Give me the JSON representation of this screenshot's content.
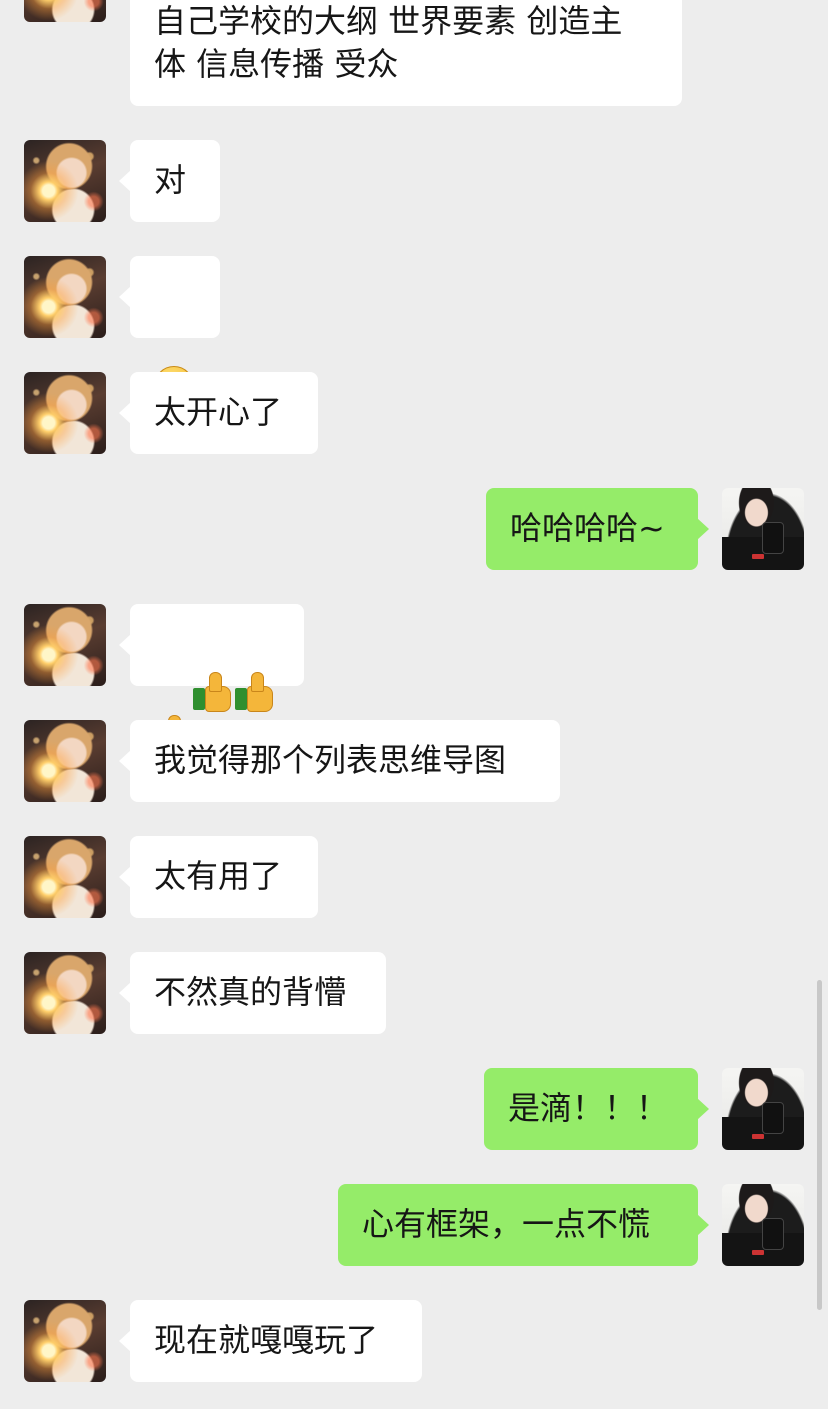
{
  "messages": [
    {
      "side": "in",
      "text": "自己学校的大纲 世界要素 创造主\n体 信息传播 受众"
    },
    {
      "side": "in",
      "text": "对"
    },
    {
      "side": "in",
      "emoji": "grinning-face"
    },
    {
      "side": "in",
      "text": "太开心了"
    },
    {
      "side": "out",
      "text": "哈哈哈哈~"
    },
    {
      "side": "in",
      "emoji": "thumbs-up-x3"
    },
    {
      "side": "in",
      "text": "我觉得那个列表思维导图"
    },
    {
      "side": "in",
      "text": "太有用了"
    },
    {
      "side": "in",
      "text": "不然真的背懵"
    },
    {
      "side": "out",
      "text": "是滴！！！"
    },
    {
      "side": "out",
      "text": "心有框架，一点不慌"
    },
    {
      "side": "in",
      "text": "现在就嘎嘎玩了"
    }
  ],
  "colors": {
    "background": "#ededed",
    "incoming_bubble": "#ffffff",
    "outgoing_bubble": "#95ec69",
    "text": "#161616"
  }
}
